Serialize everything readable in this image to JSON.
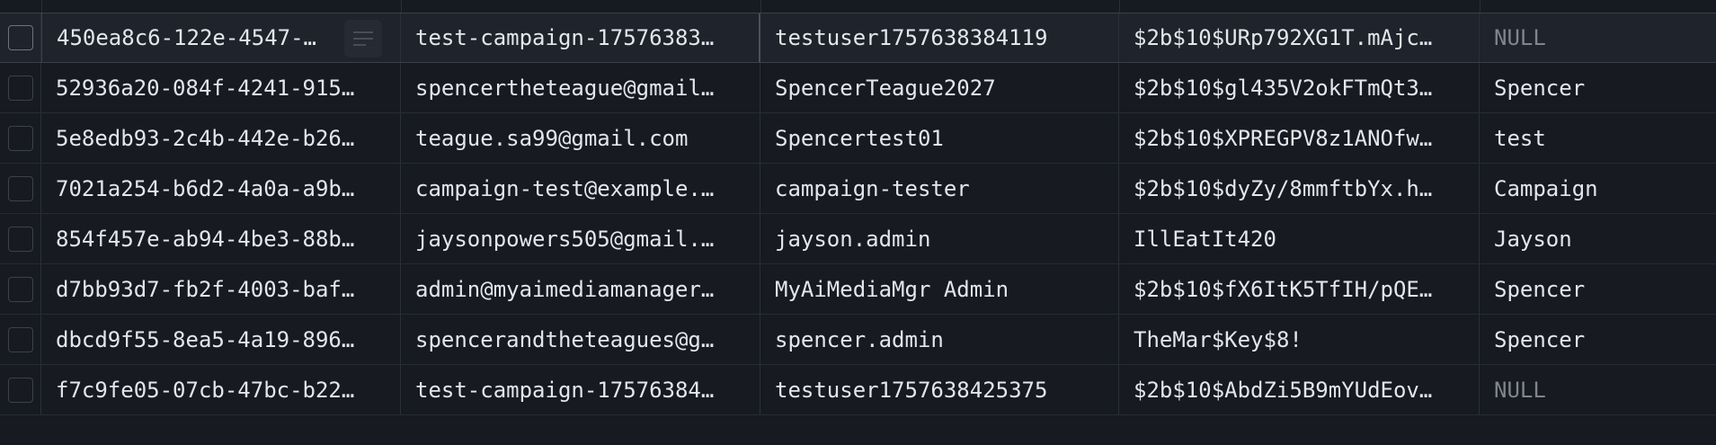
{
  "rows": [
    {
      "id": "450ea8c6-122e-4547-…",
      "email": "test-campaign-17576383…",
      "username": "testuser1757638384119",
      "password": "$2b$10$URp792XG1T.mAjc…",
      "first_name": "NULL",
      "first_name_null": true,
      "selected": true
    },
    {
      "id": "52936a20-084f-4241-915…",
      "email": "spencertheteague@gmail…",
      "username": "SpencerTeague2027",
      "password": "$2b$10$gl435V2okFTmQt3…",
      "first_name": "Spencer",
      "first_name_null": false,
      "selected": false
    },
    {
      "id": "5e8edb93-2c4b-442e-b26…",
      "email": "teague.sa99@gmail.com",
      "username": "Spencertest01",
      "password": "$2b$10$XPREGPV8z1ANOfw…",
      "first_name": "test",
      "first_name_null": false,
      "selected": false
    },
    {
      "id": "7021a254-b6d2-4a0a-a9b…",
      "email": "campaign-test@example.…",
      "username": "campaign-tester",
      "password": "$2b$10$dyZy/8mmftbYx.h…",
      "first_name": "Campaign",
      "first_name_null": false,
      "selected": false
    },
    {
      "id": "854f457e-ab94-4be3-88b…",
      "email": "jaysonpowers505@gmail.…",
      "username": "jayson.admin",
      "password": "IllEatIt420",
      "first_name": "Jayson",
      "first_name_null": false,
      "selected": false
    },
    {
      "id": "d7bb93d7-fb2f-4003-baf…",
      "email": "admin@myaimediamanager…",
      "username": "MyAiMediaMgr Admin",
      "password": "$2b$10$fX6ItK5TfIH/pQE…",
      "first_name": "Spencer",
      "first_name_null": false,
      "selected": false
    },
    {
      "id": "dbcd9f55-8ea5-4a19-896…",
      "email": "spencerandtheteagues@g…",
      "username": "spencer.admin",
      "password": "TheMar$Key$8!",
      "first_name": "Spencer",
      "first_name_null": false,
      "selected": false
    },
    {
      "id": "f7c9fe05-07cb-47bc-b22…",
      "email": "test-campaign-17576384…",
      "username": "testuser1757638425375",
      "password": "$2b$10$AbdZi5B9mYUdEov…",
      "first_name": "NULL",
      "first_name_null": true,
      "selected": false
    }
  ],
  "icons": {
    "expand": "text-lines-icon"
  }
}
